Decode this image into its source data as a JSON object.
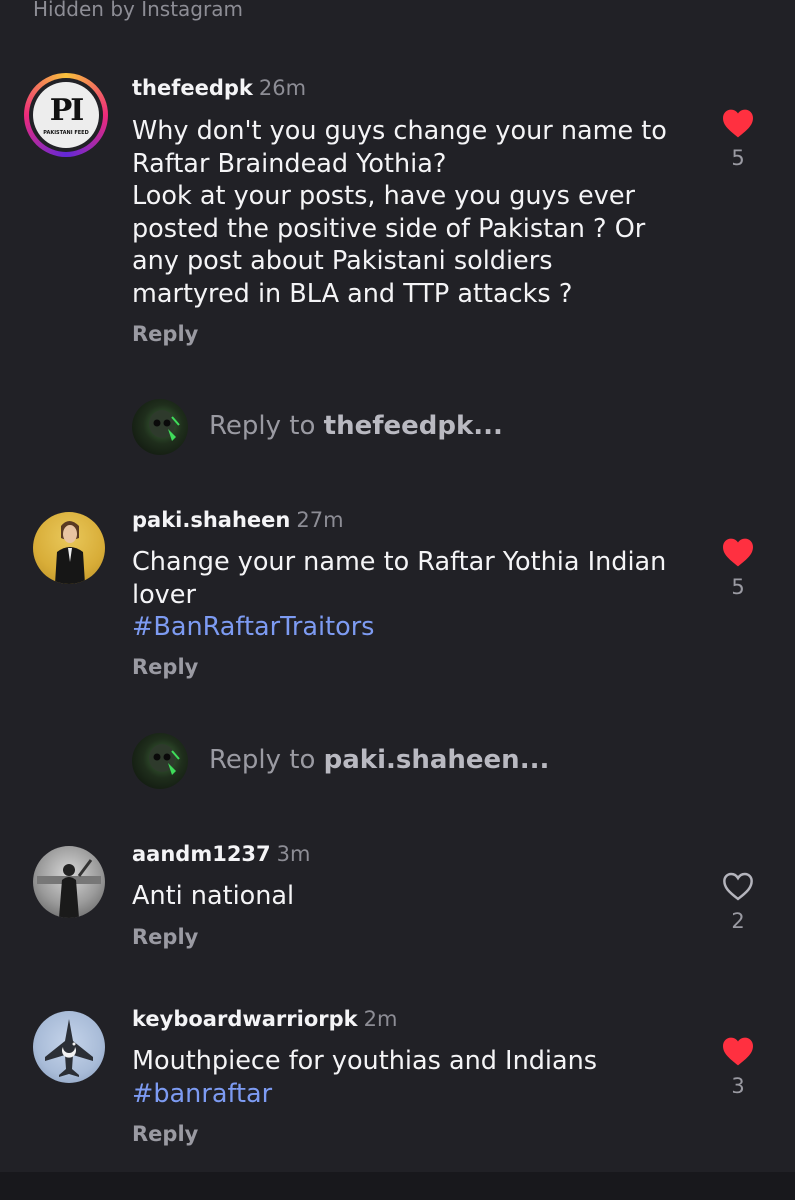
{
  "hidden_label": "Hidden by Instagram",
  "comments": [
    {
      "username": "thefeedpk",
      "time": "26m",
      "lines": [
        "Why don't you guys change your name to",
        "Raftar Braindead Yothia?",
        "Look at your posts, have you guys ever",
        "posted the positive side of Pakistan ? Or",
        "any post about Pakistani soldiers",
        "martyred in BLA and TTP attacks ?"
      ],
      "hashtag": "",
      "reply_label": "Reply",
      "liked": true,
      "likes": "5",
      "avatar_text": "PI",
      "avatar_subtext": "PAKISTANI FEED"
    },
    {
      "username": "paki.shaheen",
      "time": "27m",
      "lines": [
        "Change your name to Raftar Yothia Indian",
        "lover"
      ],
      "hashtag": "#BanRaftarTraitors",
      "reply_label": "Reply",
      "liked": true,
      "likes": "5"
    },
    {
      "username": "aandm1237",
      "time": "3m",
      "lines": [
        "Anti national"
      ],
      "hashtag": "",
      "reply_label": "Reply",
      "liked": false,
      "likes": "2"
    },
    {
      "username": "keyboardwarriorpk",
      "time": "2m",
      "lines": [
        "Mouthpiece for youthias and Indians"
      ],
      "hashtag": "#banraftar",
      "reply_label": "Reply",
      "liked": true,
      "likes": "3"
    }
  ],
  "reply_prompts": [
    {
      "prefix": "Reply to ",
      "target": "thefeedpk..."
    },
    {
      "prefix": "Reply to ",
      "target": "paki.shaheen..."
    }
  ],
  "colors": {
    "background": "#212126",
    "like_red": "#ff3040",
    "hashtag_blue": "#7d9bf2",
    "muted": "#9a9aa2"
  }
}
